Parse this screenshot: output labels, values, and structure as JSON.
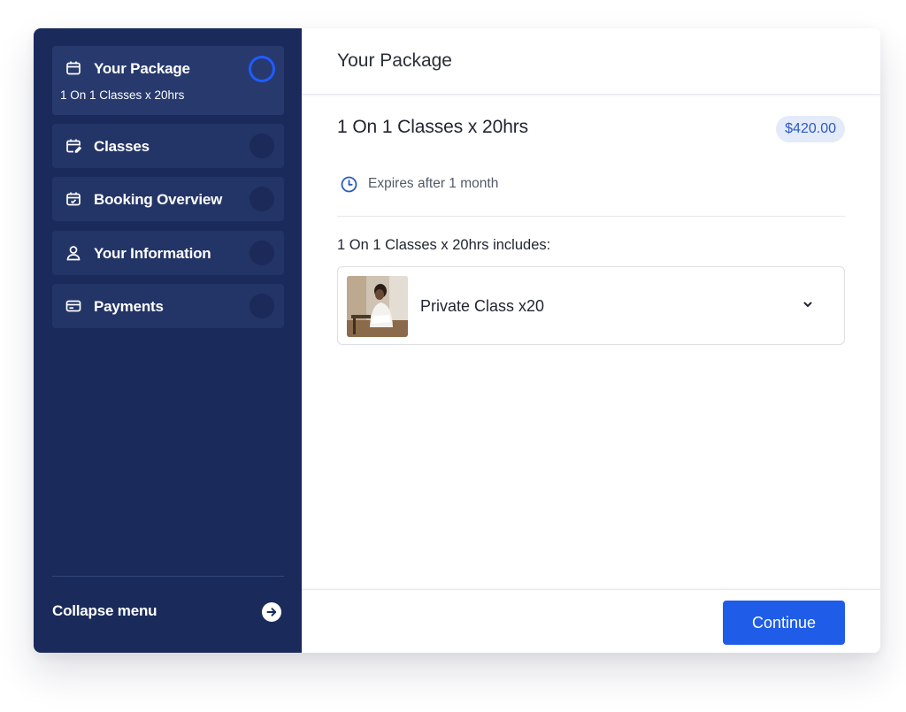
{
  "sidebar": {
    "steps": [
      {
        "title": "Your Package",
        "subtitle": "1 On 1 Classes x 20hrs",
        "icon": "calendar-icon",
        "active": true
      },
      {
        "title": "Classes",
        "icon": "calendar-edit-icon",
        "active": false
      },
      {
        "title": "Booking Overview",
        "icon": "calendar-check-icon",
        "active": false
      },
      {
        "title": "Your Information",
        "icon": "user-icon",
        "active": false
      },
      {
        "title": "Payments",
        "icon": "credit-card-icon",
        "active": false
      }
    ],
    "collapse_label": "Collapse menu",
    "collapse_icon": "arrow-right-circle-icon"
  },
  "main": {
    "title": "Your Package",
    "package": {
      "name": "1 On 1 Classes x 20hrs",
      "price": "$420.00",
      "expires": "Expires after 1 month",
      "expires_icon": "clock-icon",
      "includes_label": "1 On 1 Classes x 20hrs includes:",
      "items": [
        {
          "name": "Private Class x20",
          "thumbnail": "class-photo",
          "icon": "chevron-down-icon"
        }
      ]
    },
    "continue_label": "Continue"
  },
  "colors": {
    "sidebar_bg": "#1a2a5b",
    "sidebar_step_bg": "#233466",
    "active_ring": "#1f5cff",
    "primary_button": "#1f5ce8",
    "price_badge_bg": "#e3ebfb",
    "price_badge_text": "#2b59c3"
  }
}
